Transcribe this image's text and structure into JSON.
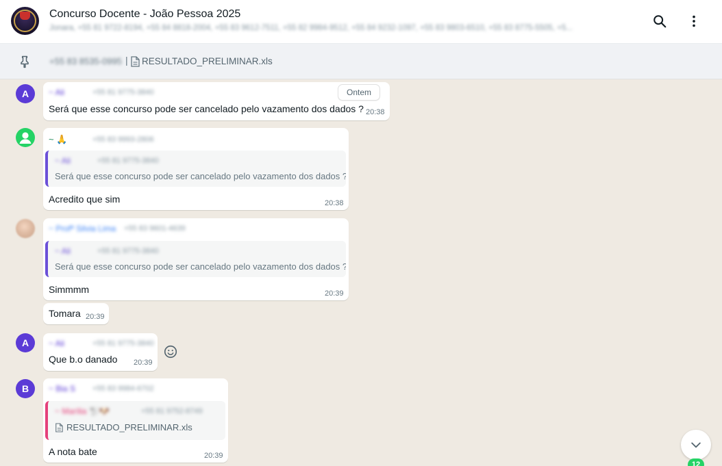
{
  "header": {
    "title": "Concurso Docente - João Pessoa 2025",
    "participants": "Jonara, +55 81 9722-8194, +55 84 8818-2004, +55 83 9612-7511, +55 82 9984-9512, +55 84 9232-1097, +55 83 9803-6510, +55 83 8775-5505, +5..."
  },
  "pinned": {
    "sender": "+55 83 8535-0995",
    "separator": "|",
    "file": "RESULTADO_PRELIMINAR.xls"
  },
  "date_chip": "Ontem",
  "messages": [
    {
      "avatar": "A",
      "sender": "~ Ali",
      "phone": "+55 81 9775-3840",
      "text": "Será que esse concurso pode ser cancelado pelo vazamento dos dados ?",
      "time": "20:38"
    },
    {
      "sender": "~ 🙏",
      "phone": "+55 83 9993-2806",
      "quote": {
        "sender": "~ Ali",
        "phone": "+55 81 9775-3840",
        "text": "Será que esse concurso pode ser cancelado pelo vazamento dos dados ?"
      },
      "text": "Acredito que sim",
      "time": "20:38"
    },
    {
      "sender": "~ Profª Silvia Lima",
      "phone": "+55 83 9601-4639",
      "quote": {
        "sender": "~ Ali",
        "phone": "+55 81 9775-3840",
        "text": "Será que esse concurso pode ser cancelado pelo vazamento dos dados ?"
      },
      "text": "Simmmm",
      "time": "20:39"
    },
    {
      "text": "Tomara",
      "time": "20:39"
    },
    {
      "avatar": "A",
      "sender": "~ Ali",
      "phone": "+55 81 9775-3840",
      "text": "Que b.o danado",
      "time": "20:39"
    },
    {
      "avatar": "B",
      "sender": "~ Bia S",
      "phone": "+55 83 9984-6702",
      "quote": {
        "sender": "~ Marília 🐩🐶",
        "phone": "+55 81 9752-8749",
        "file": "RESULTADO_PRELIMINAR.xls"
      },
      "text": "A nota bate",
      "time": "20:39"
    }
  ],
  "unread_count": "12",
  "colors": {
    "chat_bg": "#efeae2",
    "accent_green": "#25d366",
    "avatar_purple": "#5b3bd6",
    "quote_bar_purple": "#6b4fd8",
    "quote_bar_pink": "#e5407a"
  },
  "icons": {
    "search": "search-icon",
    "menu": "kebab-menu-icon",
    "pin": "pin-icon",
    "document": "document-icon",
    "emoji": "emoji-smile-icon",
    "scroll_down": "chevron-down-icon"
  }
}
